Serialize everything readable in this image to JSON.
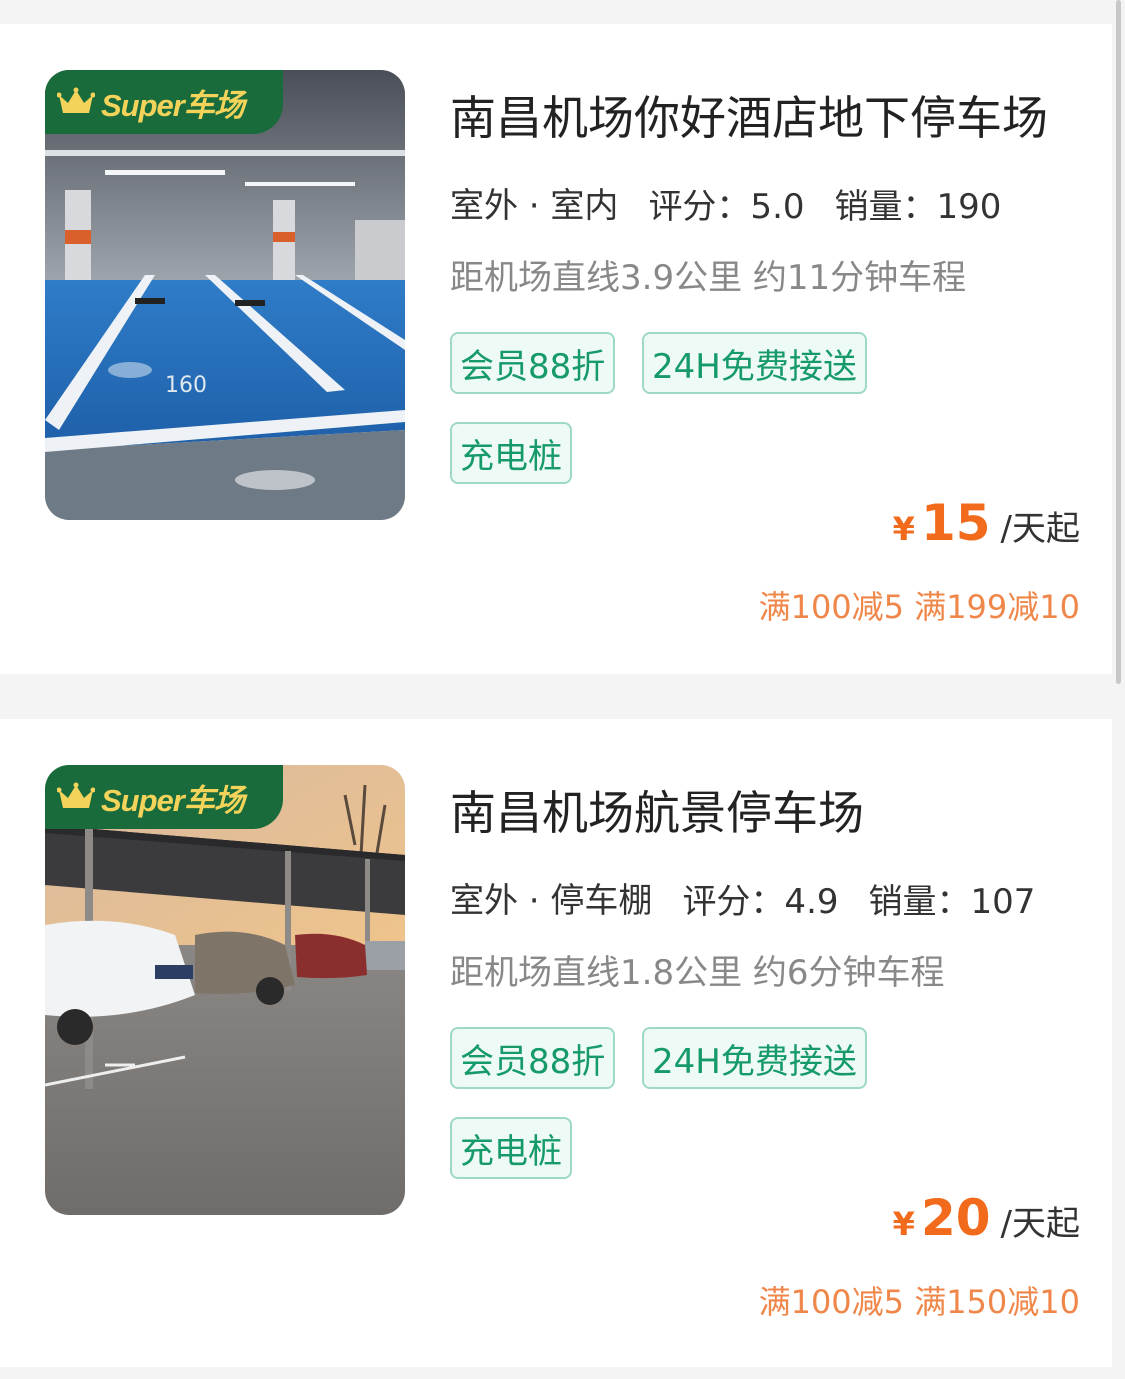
{
  "badge_text": "Super车场",
  "colors": {
    "badge_bg": "#1a6b3c",
    "badge_text": "#f3d35a",
    "tag_text": "#169a6a",
    "price": "#f26b1d",
    "promo": "#f0874a"
  },
  "lots": [
    {
      "name": "南昌机场你好酒店地下停车场",
      "type": "室外 · 室内",
      "rating": "评分：5.0",
      "sales": "销量：190",
      "distance": "距机场直线3.9公里 约11分钟车程",
      "tags": [
        "会员88折",
        "24H免费接送",
        "充电桩"
      ],
      "price_symbol": "¥",
      "price": "15",
      "price_unit": "/天起",
      "promo": "满100减5 满199减10",
      "photo_icon": "underground-parking-photo"
    },
    {
      "name": "南昌机场航景停车场",
      "type": "室外 · 停车棚",
      "rating": "评分：4.9",
      "sales": "销量：107",
      "distance": "距机场直线1.8公里 约6分钟车程",
      "tags": [
        "会员88折",
        "24H免费接送",
        "充电桩"
      ],
      "price_symbol": "¥",
      "price": "20",
      "price_unit": "/天起",
      "promo": "满100减5 满150减10",
      "photo_icon": "carport-parking-photo"
    }
  ]
}
